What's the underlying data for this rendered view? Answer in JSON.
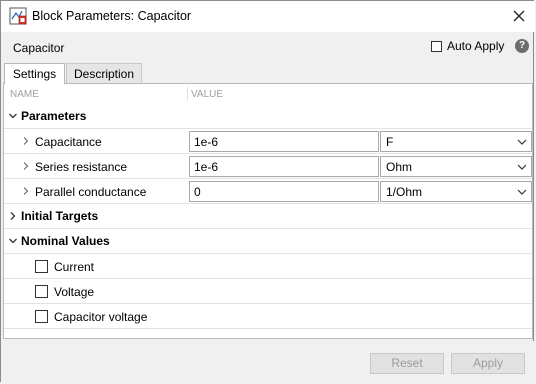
{
  "window": {
    "title": "Block Parameters: Capacitor"
  },
  "dialog": {
    "block_name": "Capacitor",
    "auto_apply": {
      "label": "Auto Apply",
      "checked": false
    },
    "help_label": "?"
  },
  "tabs": [
    {
      "label": "Settings",
      "active": true
    },
    {
      "label": "Description",
      "active": false
    }
  ],
  "table": {
    "columns": {
      "name": "NAME",
      "value": "VALUE"
    },
    "sections": {
      "parameters": {
        "label": "Parameters",
        "expanded": true,
        "rows": [
          {
            "label": "Capacitance",
            "value": "1e-6",
            "unit": "F"
          },
          {
            "label": "Series resistance",
            "value": "1e-6",
            "unit": "Ohm"
          },
          {
            "label": "Parallel conductance",
            "value": "0",
            "unit": "1/Ohm"
          }
        ]
      },
      "initial_targets": {
        "label": "Initial Targets",
        "expanded": false
      },
      "nominal_values": {
        "label": "Nominal Values",
        "expanded": true,
        "items": [
          {
            "label": "Current",
            "checked": false
          },
          {
            "label": "Voltage",
            "checked": false
          },
          {
            "label": "Capacitor voltage",
            "checked": false
          }
        ]
      }
    }
  },
  "buttons": {
    "reset": "Reset",
    "apply": "Apply",
    "enabled": false
  },
  "colors": {
    "title_bg": "#ffffff",
    "dialog_bg": "#f0f0f0",
    "disabled_text": "#9c9c9c",
    "icon_red": "#d9352a"
  }
}
